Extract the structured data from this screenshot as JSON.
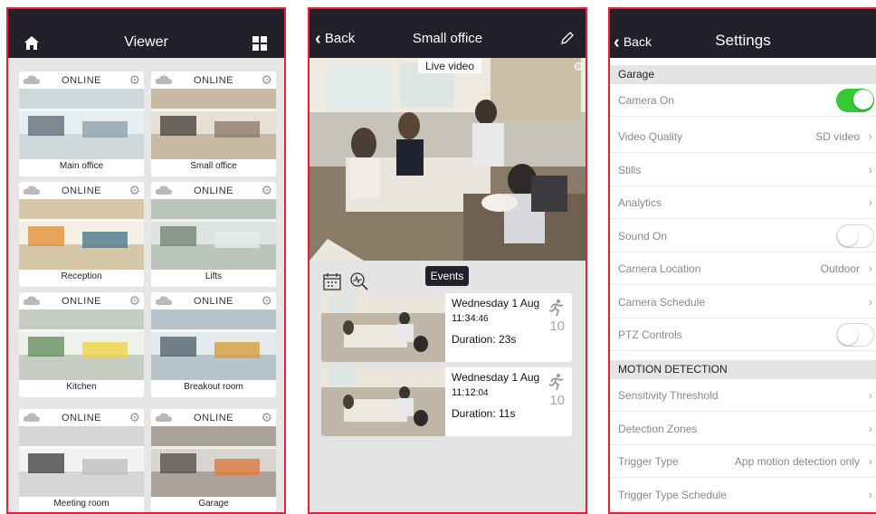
{
  "viewer": {
    "title": "Viewer",
    "cameras": [
      {
        "status": "ONLINE",
        "name": "Main office"
      },
      {
        "status": "ONLINE",
        "name": "Small office"
      },
      {
        "status": "ONLINE",
        "name": "Reception"
      },
      {
        "status": "ONLINE",
        "name": "Lifts"
      },
      {
        "status": "ONLINE",
        "name": "Kitchen"
      },
      {
        "status": "ONLINE",
        "name": "Breakout room"
      },
      {
        "status": "ONLINE",
        "name": "Meeting room"
      },
      {
        "status": "ONLINE",
        "name": "Garage"
      }
    ]
  },
  "detail": {
    "back_label": "Back",
    "title": "Small office",
    "live_label": "Live video",
    "events_label": "Events",
    "events": [
      {
        "date": "Wednesday 1 Aug",
        "time_main": "11:34",
        "time_sec": ":46",
        "duration": "Duration: 23s",
        "count": "10"
      },
      {
        "date": "Wednesday 1 Aug",
        "time_main": "11:12",
        "time_sec": ":04",
        "duration": "Duration: 11s",
        "count": "10"
      }
    ]
  },
  "settings": {
    "back_label": "Back",
    "title": "Settings",
    "section_camera": "Garage",
    "rows": [
      {
        "label": "Camera On",
        "toggle": true
      },
      {
        "label": "Video Quality",
        "value": "SD video"
      },
      {
        "label": "Stills",
        "value": ""
      },
      {
        "label": "Analytics",
        "value": ""
      },
      {
        "label": "Sound On",
        "toggle": false
      },
      {
        "label": "Camera Location",
        "value": "Outdoor"
      },
      {
        "label": "Camera Schedule",
        "value": ""
      },
      {
        "label": "PTZ Controls",
        "toggle": false
      }
    ],
    "section_motion": "MOTION DETECTION",
    "motion_rows": [
      {
        "label": "Sensitivity Threshold",
        "value": ""
      },
      {
        "label": "Detection Zones",
        "value": ""
      },
      {
        "label": "Trigger Type",
        "value": "App motion detection only"
      },
      {
        "label": "Trigger Type Schedule",
        "value": ""
      }
    ]
  },
  "colors": {
    "accent": "#e8203a",
    "navbar": "#23202b",
    "toggle_on": "#35c936"
  }
}
